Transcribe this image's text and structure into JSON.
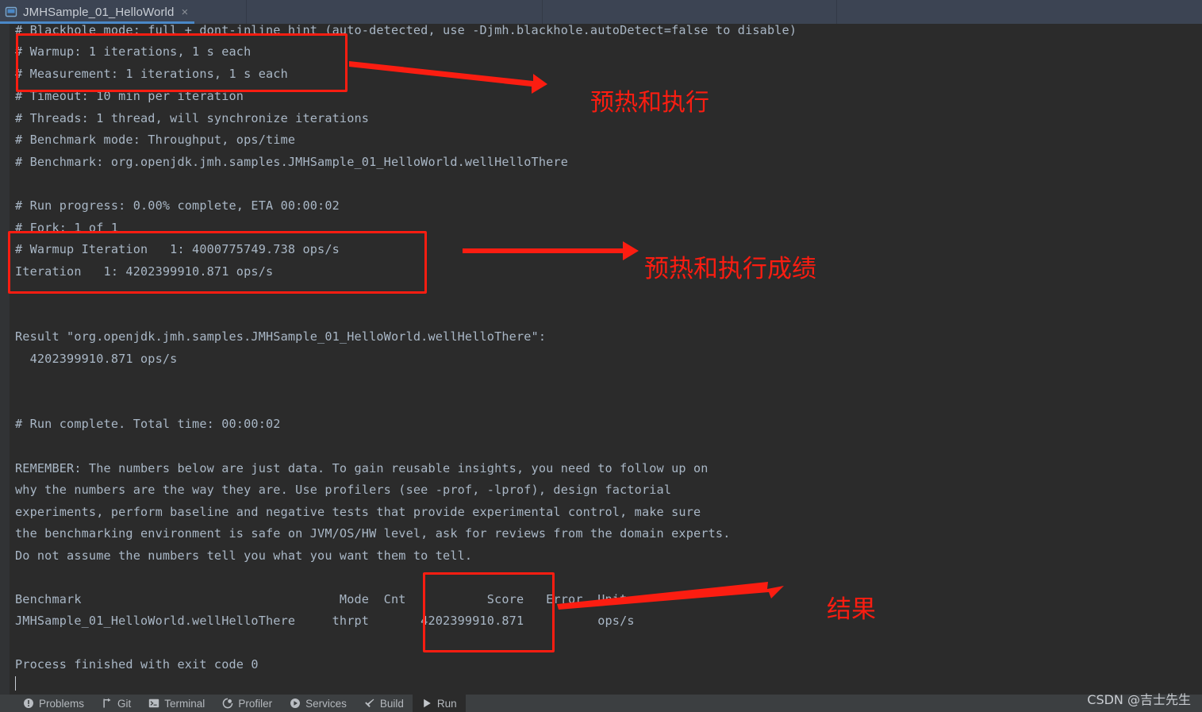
{
  "tab": {
    "title": "JMHSample_01_HelloWorld",
    "close_label": "×",
    "icon": "run-config-icon"
  },
  "console": {
    "lines": [
      "# Blackhole mode: full + dont-inline hint (auto-detected, use -Djmh.blackhole.autoDetect=false to disable)",
      "# Warmup: 1 iterations, 1 s each",
      "# Measurement: 1 iterations, 1 s each",
      "# Timeout: 10 min per iteration",
      "# Threads: 1 thread, will synchronize iterations",
      "# Benchmark mode: Throughput, ops/time",
      "# Benchmark: org.openjdk.jmh.samples.JMHSample_01_HelloWorld.wellHelloThere",
      "",
      "# Run progress: 0.00% complete, ETA 00:00:02",
      "# Fork: 1 of 1",
      "# Warmup Iteration   1: 4000775749.738 ops/s",
      "Iteration   1: 4202399910.871 ops/s",
      "",
      "",
      "Result \"org.openjdk.jmh.samples.JMHSample_01_HelloWorld.wellHelloThere\":",
      "  4202399910.871 ops/s",
      "",
      "",
      "",
      "# Run complete. Total time: 00:00:02",
      "",
      "REMEMBER: The numbers below are just data. To gain reusable insights, you need to follow up on",
      "why the numbers are the way they are. Use profilers (see -prof, -lprof), design factorial",
      "experiments, perform baseline and negative tests that provide experimental control, make sure",
      "the benchmarking environment is safe on JVM/OS/HW level, ask for reviews from the domain experts.",
      "Do not assume the numbers tell you what you want them to tell.",
      "",
      "Benchmark                                   Mode  Cnt           Score   Error  Units",
      "JMHSample_01_HelloWorld.wellHelloThere     thrpt       4202399910.871          ops/s",
      "",
      "Process finished with exit code 0"
    ]
  },
  "results_table": {
    "headers": [
      "Benchmark",
      "Mode",
      "Cnt",
      "Score",
      "Error",
      "Units"
    ],
    "rows": [
      {
        "benchmark": "JMHSample_01_HelloWorld.wellHelloThere",
        "mode": "thrpt",
        "cnt": "",
        "score": "4202399910.871",
        "error": "",
        "units": "ops/s"
      }
    ]
  },
  "benchmark_summary": {
    "warmup_iterations": "1 iterations, 1 s each",
    "measurement_iterations": "1 iterations, 1 s each",
    "timeout": "10 min per iteration",
    "threads": "1 thread, will synchronize iterations",
    "mode": "Throughput, ops/time",
    "benchmark_fqn": "org.openjdk.jmh.samples.JMHSample_01_HelloWorld.wellHelloThere",
    "run_progress": "0.00% complete, ETA 00:00:02",
    "fork": "1 of 1",
    "warmup_iteration_1": "4000775749.738 ops/s",
    "iteration_1": "4202399910.871 ops/s",
    "result_score": "4202399910.871 ops/s",
    "total_time": "00:00:02",
    "exit_code": "0"
  },
  "annotations": {
    "color": "#fb1d11",
    "notes": [
      {
        "text": "预热和执行",
        "meaning": "warmup-and-execution"
      },
      {
        "text": "预热和执行成绩",
        "meaning": "warmup-and-execution-score"
      },
      {
        "text": "结果",
        "meaning": "result"
      }
    ]
  },
  "statusbar": {
    "items": [
      {
        "label": "Problems",
        "icon": "warning-circle-icon",
        "active": false
      },
      {
        "label": "Git",
        "icon": "git-branch-icon",
        "active": false
      },
      {
        "label": "Terminal",
        "icon": "terminal-icon",
        "active": false
      },
      {
        "label": "Profiler",
        "icon": "profiler-icon",
        "active": false
      },
      {
        "label": "Services",
        "icon": "services-icon",
        "active": false
      },
      {
        "label": "Build",
        "icon": "build-hammer-icon",
        "active": false
      },
      {
        "label": "Run",
        "icon": "run-triangle-icon",
        "active": true
      }
    ]
  },
  "watermark": {
    "text": "CSDN @吉士先生"
  }
}
